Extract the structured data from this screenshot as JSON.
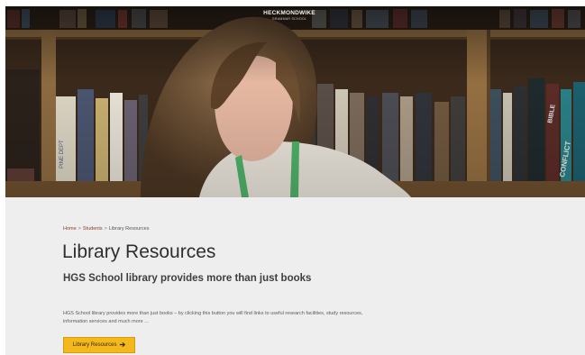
{
  "header": {
    "logo_line1": "HECKMONDWIKE",
    "logo_line2": "GRAMMAR SCHOOL"
  },
  "hero": {
    "book_spine_text": [
      "PINE DEPT",
      "BIBLE",
      "CONFLICT"
    ]
  },
  "breadcrumb": {
    "items": [
      "Home",
      "Students"
    ],
    "separator": ">",
    "current": "Library Resources"
  },
  "main": {
    "title": "Library Resources",
    "subtitle": "HGS School library provides more than just books",
    "description": "HGS School library provides more than just books – by clicking this button you will find links to useful research facilities, study resources, information services and much more ...",
    "cta_label": "Library Resources",
    "cta_icon": "arrow-right-icon"
  },
  "colors": {
    "accent": "#f2b81c",
    "breadcrumb_link": "#8a3b2c",
    "background": "#eeeeee"
  }
}
